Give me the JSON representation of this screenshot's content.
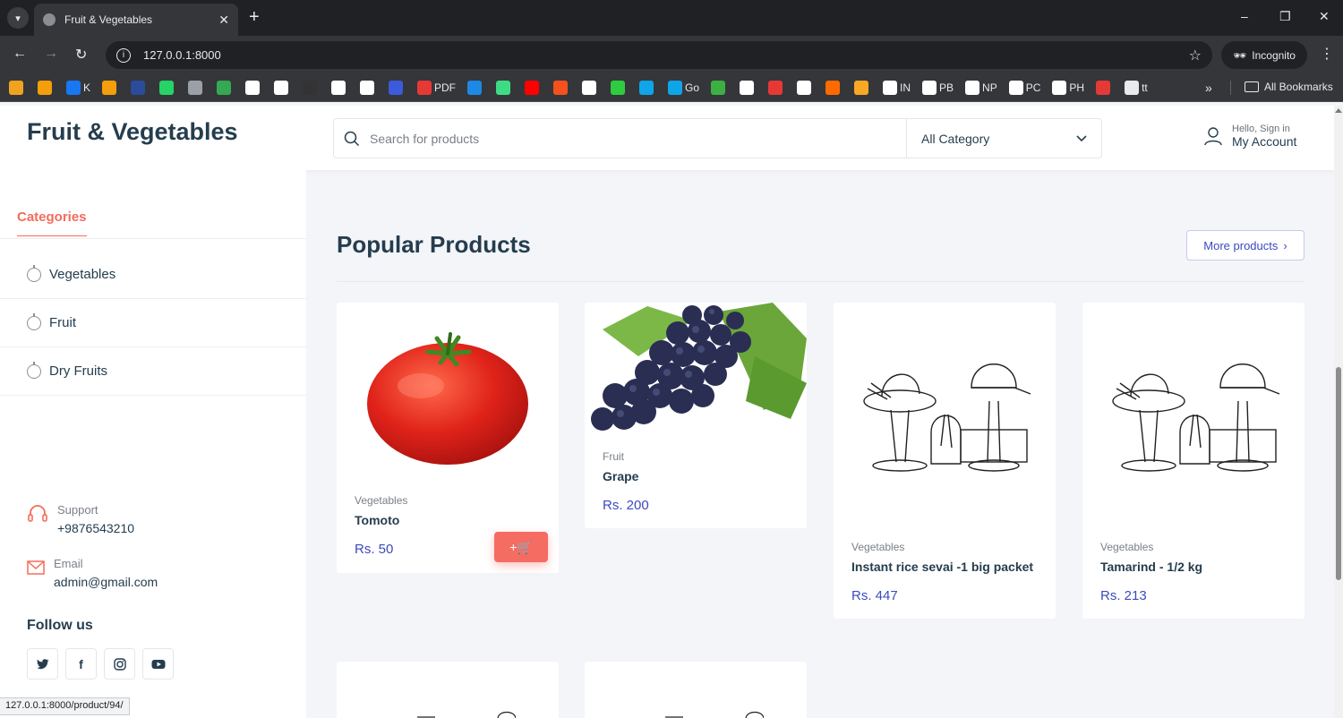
{
  "browser": {
    "tab_title": "Fruit & Vegetables",
    "tab_close": "✕",
    "new_tab": "+",
    "url": "127.0.0.1:8000",
    "incognito_label": "Incognito",
    "window_controls": [
      "–",
      "❐",
      "✕"
    ],
    "bookmarks": [
      {
        "label": "",
        "color": "#f0a31e"
      },
      {
        "label": "",
        "color": "#f59e0b"
      },
      {
        "label": "K",
        "color": "#1877f2"
      },
      {
        "label": "",
        "color": "#f59e0b"
      },
      {
        "label": "",
        "color": "#2b4b9b"
      },
      {
        "label": "",
        "color": "#25d366"
      },
      {
        "label": "",
        "color": "#9aa0a6"
      },
      {
        "label": "",
        "color": "#34a853"
      },
      {
        "label": "",
        "color": "#ffffff"
      },
      {
        "label": "",
        "color": "#ffffff"
      },
      {
        "label": "",
        "color": "#333333"
      },
      {
        "label": "",
        "color": "#ffffff"
      },
      {
        "label": "",
        "color": "#ffffff"
      },
      {
        "label": "",
        "color": "#3b5bdb"
      },
      {
        "label": "PDF",
        "color": "#e53935"
      },
      {
        "label": "",
        "color": "#1e88e5"
      },
      {
        "label": "",
        "color": "#3ddc84"
      },
      {
        "label": "",
        "color": "#ff0000"
      },
      {
        "label": "",
        "color": "#f4511e"
      },
      {
        "label": "",
        "color": "#ffffff"
      },
      {
        "label": "",
        "color": "#2ecc40"
      },
      {
        "label": "",
        "color": "#0ea5e9"
      },
      {
        "label": "Go",
        "color": "#0ea5e9"
      },
      {
        "label": "",
        "color": "#3cb043"
      },
      {
        "label": "",
        "color": "#ffffff"
      },
      {
        "label": "",
        "color": "#e53935"
      },
      {
        "label": "",
        "color": "#ffffff"
      },
      {
        "label": "",
        "color": "#ff6a00"
      },
      {
        "label": "",
        "color": "#f9a825"
      },
      {
        "label": "IN",
        "color": "#ffffff"
      },
      {
        "label": "PB",
        "color": "#ffffff"
      },
      {
        "label": "NP",
        "color": "#ffffff"
      },
      {
        "label": "PC",
        "color": "#ffffff"
      },
      {
        "label": "PH",
        "color": "#ffffff"
      },
      {
        "label": "",
        "color": "#e53935"
      },
      {
        "label": "tt",
        "color": "#e8eaed"
      }
    ],
    "bookmarks_more": "»",
    "all_bookmarks": "All Bookmarks",
    "status_url": "127.0.0.1:8000/product/94/"
  },
  "header": {
    "brand": "Fruit & Vegetables",
    "search_placeholder": "Search for products",
    "category_select": "All Category",
    "account_greeting": "Hello, Sign in",
    "account_label": "My Account"
  },
  "sidebar": {
    "categories_title": "Categories",
    "categories": [
      "Vegetables",
      "Fruit",
      "Dry Fruits"
    ],
    "support_label": "Support",
    "support_value": "+9876543210",
    "email_label": "Email",
    "email_value": "admin@gmail.com",
    "follow_title": "Follow us",
    "social_icons": [
      "twitter-icon",
      "facebook-icon",
      "instagram-icon",
      "youtube-icon"
    ]
  },
  "main": {
    "section_title": "Popular Products",
    "more_products": "More products",
    "products": [
      {
        "category": "Vegetables",
        "name": "Tomoto",
        "price": "Rs. 50",
        "image": "tomato"
      },
      {
        "category": "Fruit",
        "name": "Grape",
        "price": "Rs. 200",
        "image": "grapes"
      },
      {
        "category": "Vegetables",
        "name": "Instant rice sevai -1 big packet",
        "price": "Rs. 447",
        "image": "hats-sketch"
      },
      {
        "category": "Vegetables",
        "name": "Tamarind - 1/2 kg",
        "price": "Rs. 213",
        "image": "hats-sketch"
      }
    ],
    "cart_button": "+🛒"
  },
  "colors": {
    "accent": "#f36c5c",
    "price": "#3b4bbf",
    "text": "#253d4e"
  }
}
